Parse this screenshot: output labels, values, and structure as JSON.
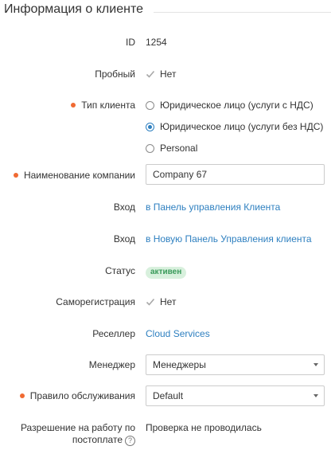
{
  "section": {
    "title": "Информация о клиенте"
  },
  "fields": {
    "id": {
      "label": "ID",
      "value": "1254"
    },
    "trial": {
      "label": "Пробный",
      "value": "Нет",
      "icon": "check-icon"
    },
    "client_type": {
      "label": "Тип клиента",
      "options": [
        {
          "label": "Юридическое лицо (услуги с НДС)",
          "selected": false
        },
        {
          "label": "Юридическое лицо (услуги без НДС)",
          "selected": true
        },
        {
          "label": "Personal",
          "selected": false
        }
      ]
    },
    "company_name": {
      "label": "Наименование компании",
      "value": "Company 67"
    },
    "login1": {
      "label": "Вход",
      "link": "в Панель управления Клиента"
    },
    "login2": {
      "label": "Вход",
      "link": "в Новую Панель Управления клиента"
    },
    "status": {
      "label": "Статус",
      "value": "активен"
    },
    "self_registration": {
      "label": "Саморегистрация",
      "value": "Нет",
      "icon": "check-icon"
    },
    "reseller": {
      "label": "Реселлер",
      "link": "Cloud Services"
    },
    "manager": {
      "label": "Менеджер",
      "value": "Менеджеры"
    },
    "service_rule": {
      "label": "Правило обслуживания",
      "value": "Default"
    },
    "postpaid": {
      "label_line1": "Разрешение на работу по",
      "label_line2": "постоплате",
      "value": "Проверка не проводилась",
      "help_icon": "?"
    }
  },
  "colors": {
    "required_dot": "#f06a32",
    "link": "#2f80c0",
    "badge_bg": "#d8f0dd",
    "badge_text": "#3a9a5a"
  }
}
